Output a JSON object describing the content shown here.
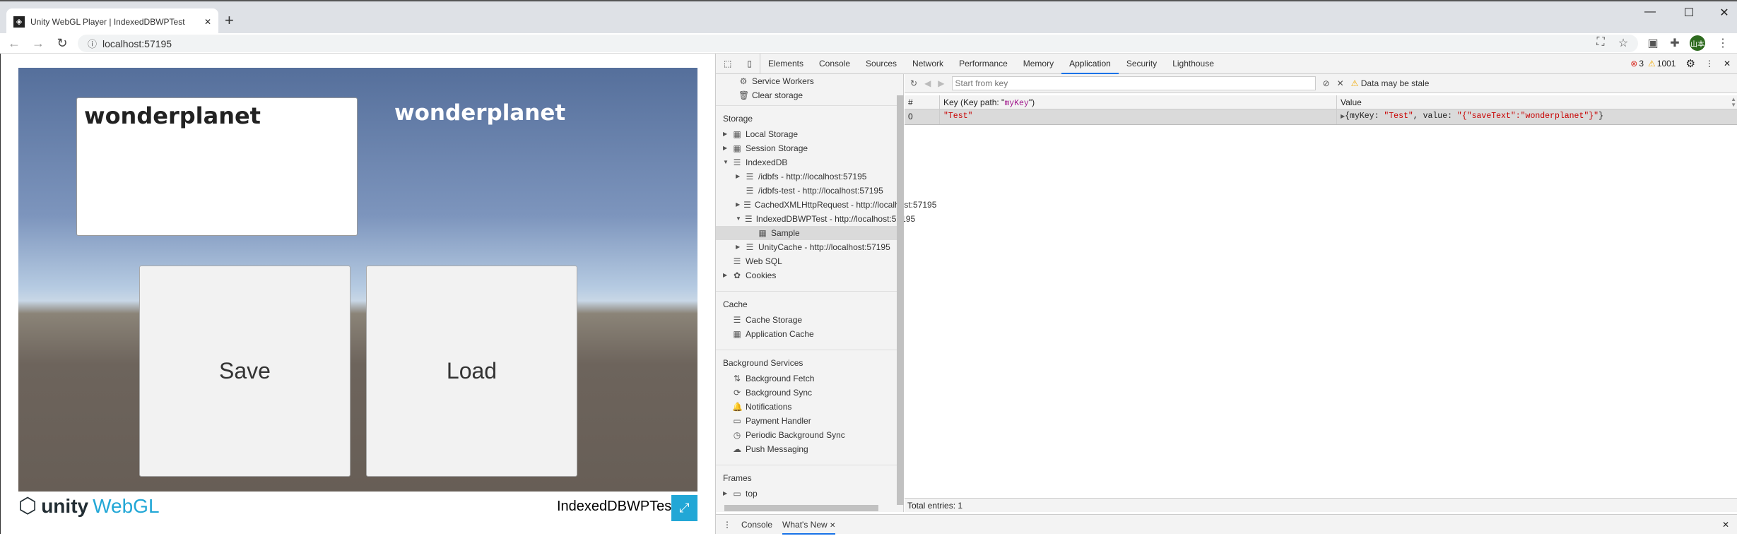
{
  "browser": {
    "tab_title": "Unity WebGL Player | IndexedDBWPTest",
    "url": "localhost:57195",
    "avatar_text": "山本",
    "new_tab": "+",
    "tab_close": "✕"
  },
  "unity": {
    "input_text": "wonderplanet",
    "label_text": "wonderplanet",
    "save_label": "Save",
    "load_label": "Load",
    "logo_unity": "unity",
    "logo_webgl": "WebGL",
    "game_title": "IndexedDBWPTest"
  },
  "devtools": {
    "tabs": [
      "Elements",
      "Console",
      "Sources",
      "Network",
      "Performance",
      "Memory",
      "Application",
      "Security",
      "Lighthouse"
    ],
    "active_tab": "Application",
    "errors": "3",
    "warnings": "1001",
    "sidebar": {
      "top": [
        {
          "label": "Service Workers",
          "icon": "⚙"
        },
        {
          "label": "Clear storage",
          "icon": "🗑"
        }
      ],
      "sections": [
        {
          "title": "Storage",
          "items": [
            {
              "label": "Local Storage",
              "icon": "▦",
              "tri": "▶",
              "indent": 0
            },
            {
              "label": "Session Storage",
              "icon": "▦",
              "tri": "▶",
              "indent": 0
            },
            {
              "label": "IndexedDB",
              "icon": "☰",
              "tri": "▼",
              "indent": 0
            },
            {
              "label": "/idbfs - http://localhost:57195",
              "icon": "☰",
              "tri": "▶",
              "indent": 1
            },
            {
              "label": "/idbfs-test - http://localhost:57195",
              "icon": "☰",
              "tri": "",
              "indent": 1
            },
            {
              "label": "CachedXMLHttpRequest - http://localhost:57195",
              "icon": "☰",
              "tri": "▶",
              "indent": 1
            },
            {
              "label": "IndexedDBWPTest - http://localhost:57195",
              "icon": "☰",
              "tri": "▼",
              "indent": 1
            },
            {
              "label": "Sample",
              "icon": "▦",
              "tri": "",
              "indent": 2,
              "selected": true
            },
            {
              "label": "UnityCache - http://localhost:57195",
              "icon": "☰",
              "tri": "▶",
              "indent": 1
            },
            {
              "label": "Web SQL",
              "icon": "☰",
              "tri": "",
              "indent": 0
            },
            {
              "label": "Cookies",
              "icon": "✿",
              "tri": "▶",
              "indent": 0
            }
          ]
        },
        {
          "title": "Cache",
          "items": [
            {
              "label": "Cache Storage",
              "icon": "☰",
              "tri": "",
              "indent": 0
            },
            {
              "label": "Application Cache",
              "icon": "▦",
              "tri": "",
              "indent": 0
            }
          ]
        },
        {
          "title": "Background Services",
          "items": [
            {
              "label": "Background Fetch",
              "icon": "⇅",
              "tri": "",
              "indent": 0
            },
            {
              "label": "Background Sync",
              "icon": "⟳",
              "tri": "",
              "indent": 0
            },
            {
              "label": "Notifications",
              "icon": "🔔",
              "tri": "",
              "indent": 0
            },
            {
              "label": "Payment Handler",
              "icon": "▭",
              "tri": "",
              "indent": 0
            },
            {
              "label": "Periodic Background Sync",
              "icon": "◷",
              "tri": "",
              "indent": 0
            },
            {
              "label": "Push Messaging",
              "icon": "☁",
              "tri": "",
              "indent": 0
            }
          ]
        },
        {
          "title": "Frames",
          "items": [
            {
              "label": "top",
              "icon": "▭",
              "tri": "▶",
              "indent": 0
            }
          ]
        }
      ]
    },
    "toolbar": {
      "placeholder": "Start from key",
      "stale": "Data may be stale"
    },
    "table": {
      "headers": {
        "num": "#",
        "key_prefix": "Key (Key path: \"",
        "key_path": "myKey",
        "key_suffix": "\")",
        "value": "Value"
      },
      "rows": [
        {
          "num": "0",
          "key": "\"Test\"",
          "value_prefix": "{myKey: ",
          "value_key": "\"Test\"",
          "value_mid": ", value: ",
          "value_val": "\"{\"saveText\":\"wonderplanet\"}\"",
          "value_suffix": "}"
        }
      ]
    },
    "total_entries": "Total entries: 1",
    "drawer": {
      "tabs": [
        "Console",
        "What's New"
      ],
      "active": "What's New"
    }
  }
}
